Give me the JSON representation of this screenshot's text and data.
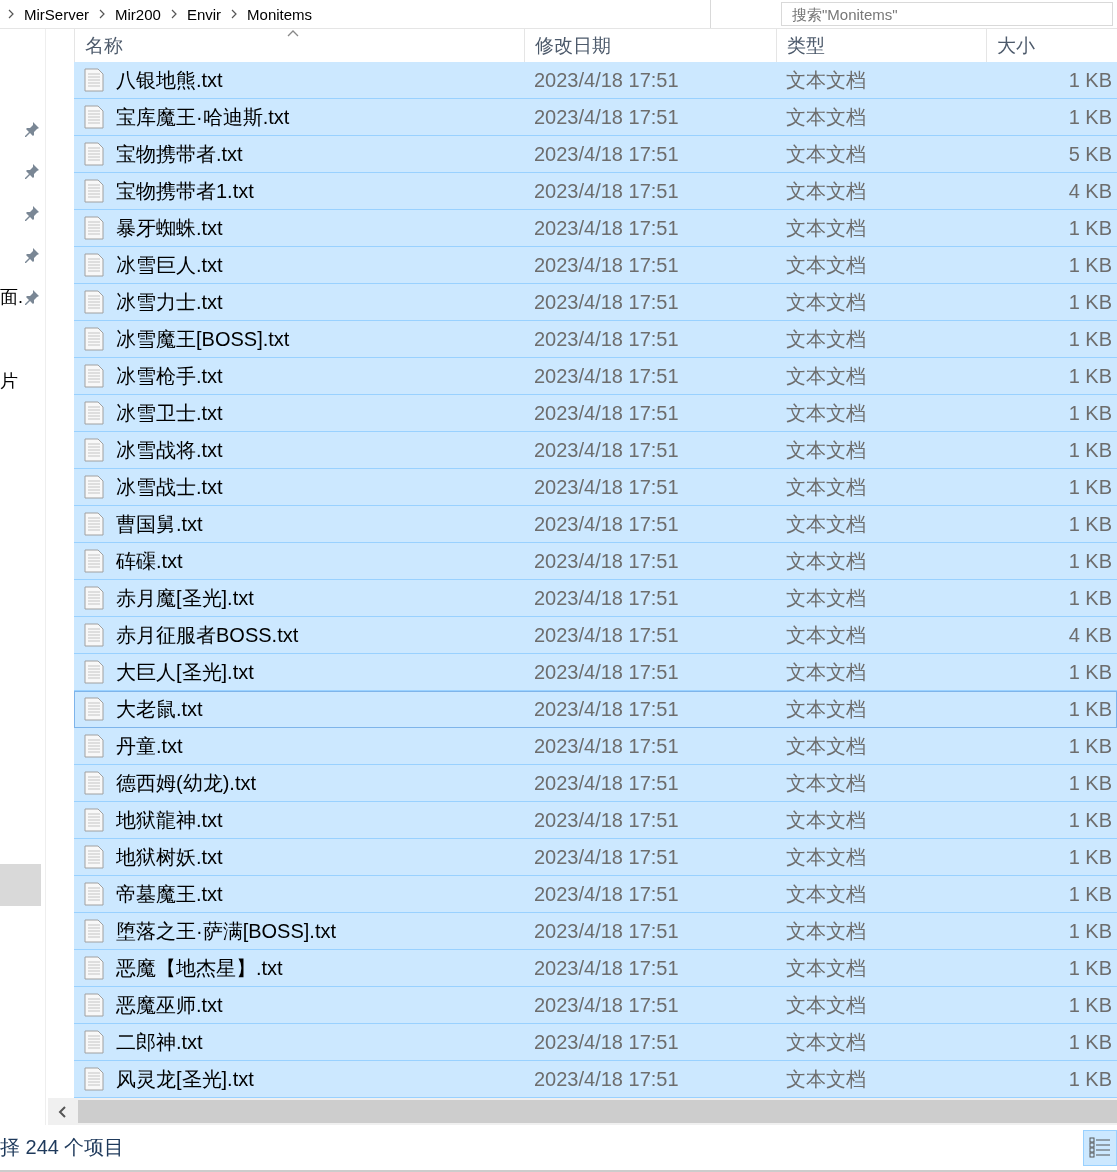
{
  "breadcrumb": [
    "MirServer",
    "Mir200",
    "Envir",
    "Monitems"
  ],
  "search": {
    "placeholder": "搜索\"Monitems\""
  },
  "sidebar": {
    "items": [
      {
        "pinned": true,
        "selected": false
      },
      {
        "pinned": true,
        "selected": false
      },
      {
        "pinned": true,
        "selected": false
      },
      {
        "pinned": true,
        "selected": false
      },
      {
        "label": "面.",
        "pinned": true,
        "selected": false
      },
      {
        "pinned": false,
        "selected": false
      },
      {
        "label": "片",
        "pinned": false,
        "selected": false
      },
      {
        "pinned": false,
        "selected": false
      },
      {
        "pinned": false,
        "selected": false
      },
      {
        "pinned": false,
        "selected": false
      },
      {
        "pinned": false,
        "selected": false
      },
      {
        "pinned": false,
        "selected": false
      },
      {
        "pinned": false,
        "selected": false
      },
      {
        "pinned": false,
        "selected": false
      },
      {
        "pinned": false,
        "selected": false
      },
      {
        "pinned": false,
        "selected": false
      },
      {
        "pinned": false,
        "selected": false
      },
      {
        "pinned": false,
        "selected": false
      },
      {
        "pinned": false,
        "selected": true
      }
    ]
  },
  "table": {
    "columns": [
      {
        "label": "名称",
        "sorted": true
      },
      {
        "label": "修改日期",
        "sorted": false
      },
      {
        "label": "类型",
        "sorted": false
      },
      {
        "label": "大小",
        "sorted": false
      }
    ],
    "rows": [
      {
        "name": "八银地熊.txt",
        "date": "2023/4/18 17:51",
        "type": "文本文档",
        "size": "1 KB",
        "selected": true,
        "focused": false
      },
      {
        "name": "宝库魔王·哈迪斯.txt",
        "date": "2023/4/18 17:51",
        "type": "文本文档",
        "size": "1 KB",
        "selected": true,
        "focused": false
      },
      {
        "name": "宝物携带者.txt",
        "date": "2023/4/18 17:51",
        "type": "文本文档",
        "size": "5 KB",
        "selected": true,
        "focused": false
      },
      {
        "name": "宝物携带者1.txt",
        "date": "2023/4/18 17:51",
        "type": "文本文档",
        "size": "4 KB",
        "selected": true,
        "focused": false
      },
      {
        "name": "暴牙蜘蛛.txt",
        "date": "2023/4/18 17:51",
        "type": "文本文档",
        "size": "1 KB",
        "selected": true,
        "focused": false
      },
      {
        "name": "冰雪巨人.txt",
        "date": "2023/4/18 17:51",
        "type": "文本文档",
        "size": "1 KB",
        "selected": true,
        "focused": false
      },
      {
        "name": "冰雪力士.txt",
        "date": "2023/4/18 17:51",
        "type": "文本文档",
        "size": "1 KB",
        "selected": true,
        "focused": false
      },
      {
        "name": "冰雪魔王[BOSS].txt",
        "date": "2023/4/18 17:51",
        "type": "文本文档",
        "size": "1 KB",
        "selected": true,
        "focused": false
      },
      {
        "name": "冰雪枪手.txt",
        "date": "2023/4/18 17:51",
        "type": "文本文档",
        "size": "1 KB",
        "selected": true,
        "focused": false
      },
      {
        "name": "冰雪卫士.txt",
        "date": "2023/4/18 17:51",
        "type": "文本文档",
        "size": "1 KB",
        "selected": true,
        "focused": false
      },
      {
        "name": "冰雪战将.txt",
        "date": "2023/4/18 17:51",
        "type": "文本文档",
        "size": "1 KB",
        "selected": true,
        "focused": false
      },
      {
        "name": "冰雪战士.txt",
        "date": "2023/4/18 17:51",
        "type": "文本文档",
        "size": "1 KB",
        "selected": true,
        "focused": false
      },
      {
        "name": "曹国舅.txt",
        "date": "2023/4/18 17:51",
        "type": "文本文档",
        "size": "1 KB",
        "selected": true,
        "focused": false
      },
      {
        "name": "砗磲.txt",
        "date": "2023/4/18 17:51",
        "type": "文本文档",
        "size": "1 KB",
        "selected": true,
        "focused": false
      },
      {
        "name": "赤月魔[圣光].txt",
        "date": "2023/4/18 17:51",
        "type": "文本文档",
        "size": "1 KB",
        "selected": true,
        "focused": false
      },
      {
        "name": "赤月征服者BOSS.txt",
        "date": "2023/4/18 17:51",
        "type": "文本文档",
        "size": "4 KB",
        "selected": true,
        "focused": false
      },
      {
        "name": "大巨人[圣光].txt",
        "date": "2023/4/18 17:51",
        "type": "文本文档",
        "size": "1 KB",
        "selected": true,
        "focused": false
      },
      {
        "name": "大老鼠.txt",
        "date": "2023/4/18 17:51",
        "type": "文本文档",
        "size": "1 KB",
        "selected": true,
        "focused": true
      },
      {
        "name": "丹童.txt",
        "date": "2023/4/18 17:51",
        "type": "文本文档",
        "size": "1 KB",
        "selected": true,
        "focused": false
      },
      {
        "name": "德西姆(幼龙).txt",
        "date": "2023/4/18 17:51",
        "type": "文本文档",
        "size": "1 KB",
        "selected": true,
        "focused": false
      },
      {
        "name": "地狱龍神.txt",
        "date": "2023/4/18 17:51",
        "type": "文本文档",
        "size": "1 KB",
        "selected": true,
        "focused": false
      },
      {
        "name": "地狱树妖.txt",
        "date": "2023/4/18 17:51",
        "type": "文本文档",
        "size": "1 KB",
        "selected": true,
        "focused": false
      },
      {
        "name": "帝墓魔王.txt",
        "date": "2023/4/18 17:51",
        "type": "文本文档",
        "size": "1 KB",
        "selected": true,
        "focused": false
      },
      {
        "name": "堕落之王·萨满[BOSS].txt",
        "date": "2023/4/18 17:51",
        "type": "文本文档",
        "size": "1 KB",
        "selected": true,
        "focused": false
      },
      {
        "name": "恶魔【地杰星】.txt",
        "date": "2023/4/18 17:51",
        "type": "文本文档",
        "size": "1 KB",
        "selected": true,
        "focused": false
      },
      {
        "name": "恶魔巫师.txt",
        "date": "2023/4/18 17:51",
        "type": "文本文档",
        "size": "1 KB",
        "selected": true,
        "focused": false
      },
      {
        "name": "二郎神.txt",
        "date": "2023/4/18 17:51",
        "type": "文本文档",
        "size": "1 KB",
        "selected": true,
        "focused": false
      },
      {
        "name": "风灵龙[圣光].txt",
        "date": "2023/4/18 17:51",
        "type": "文本文档",
        "size": "1 KB",
        "selected": true,
        "focused": false
      }
    ]
  },
  "status_bar": {
    "text": "择 244 个项目"
  }
}
